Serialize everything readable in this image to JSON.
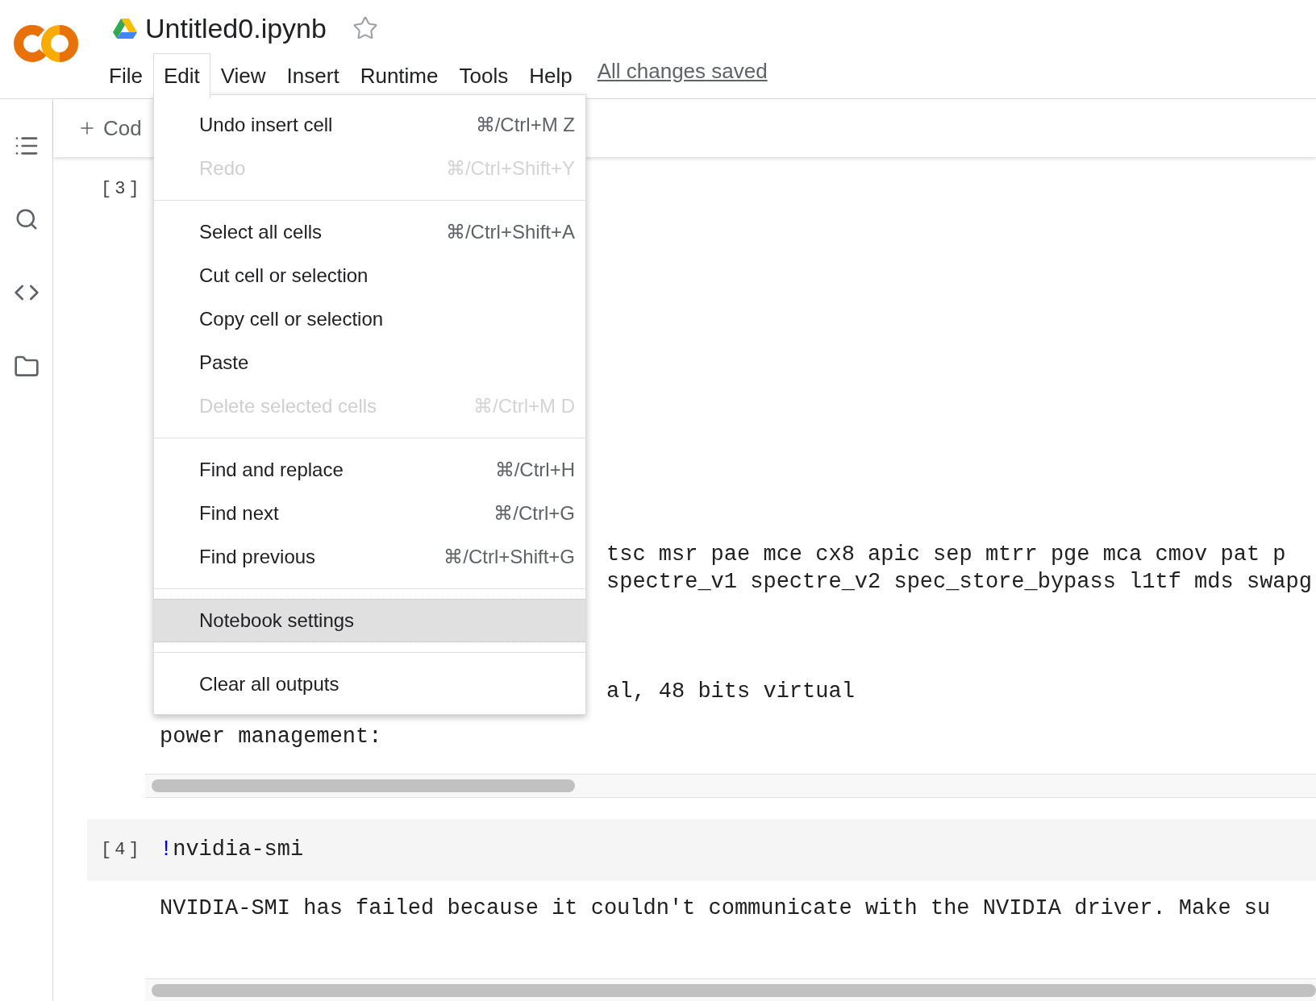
{
  "notebook": {
    "title": "Untitled0.ipynb",
    "starred": false
  },
  "menubar": [
    {
      "label": "File",
      "selected": false
    },
    {
      "label": "Edit",
      "selected": true
    },
    {
      "label": "View",
      "selected": false
    },
    {
      "label": "Insert",
      "selected": false
    },
    {
      "label": "Runtime",
      "selected": false
    },
    {
      "label": "Tools",
      "selected": false
    },
    {
      "label": "Help",
      "selected": false
    }
  ],
  "save_status": "All changes saved",
  "toolbar": {
    "add_code": "Cod"
  },
  "edit_menu": [
    {
      "kind": "item",
      "label": "Undo insert cell",
      "shortcut": "⌘/Ctrl+M Z",
      "disabled": false,
      "selected": false
    },
    {
      "kind": "item",
      "label": "Redo",
      "shortcut": "⌘/Ctrl+Shift+Y",
      "disabled": true,
      "selected": false
    },
    {
      "kind": "separator"
    },
    {
      "kind": "item",
      "label": "Select all cells",
      "shortcut": "⌘/Ctrl+Shift+A",
      "disabled": false,
      "selected": false
    },
    {
      "kind": "item",
      "label": "Cut cell or selection",
      "disabled": false,
      "selected": false
    },
    {
      "kind": "item",
      "label": "Copy cell or selection",
      "disabled": false,
      "selected": false
    },
    {
      "kind": "item",
      "label": "Paste",
      "disabled": false,
      "selected": false
    },
    {
      "kind": "item",
      "label": "Delete selected cells",
      "shortcut": "⌘/Ctrl+M D",
      "disabled": true,
      "selected": false
    },
    {
      "kind": "separator"
    },
    {
      "kind": "item",
      "label": "Find and replace",
      "shortcut": "⌘/Ctrl+H",
      "disabled": false,
      "selected": false
    },
    {
      "kind": "item",
      "label": "Find next",
      "shortcut": "⌘/Ctrl+G",
      "disabled": false,
      "selected": false
    },
    {
      "kind": "item",
      "label": "Find previous",
      "shortcut": "⌘/Ctrl+Shift+G",
      "disabled": false,
      "selected": false
    },
    {
      "kind": "separator"
    },
    {
      "kind": "item",
      "label": "Notebook settings",
      "disabled": false,
      "selected": true
    },
    {
      "kind": "separator"
    },
    {
      "kind": "item",
      "label": "Clear all outputs",
      "disabled": false,
      "selected": false
    }
  ],
  "cells": [
    {
      "execution_count": "[3]",
      "output_blocks": [
        {
          "kind": "tail",
          "lines": [
            "tsc msr pae mce cx8 apic sep mtrr pge mca cmov pat p",
            "spectre_v1 spectre_v2 spec_store_bypass l1tf mds swapg"
          ]
        },
        {
          "kind": "tail",
          "lines": [
            "al, 48 bits virtual"
          ]
        },
        {
          "kind": "full",
          "lines": [
            "power management:"
          ]
        }
      ]
    },
    {
      "execution_count": "[4]",
      "magic": "!",
      "command": "nvidia-smi",
      "output_blocks": [
        {
          "kind": "full",
          "lines": [
            "NVIDIA-SMI has failed because it couldn't communicate with the NVIDIA driver. Make su"
          ]
        }
      ]
    }
  ]
}
